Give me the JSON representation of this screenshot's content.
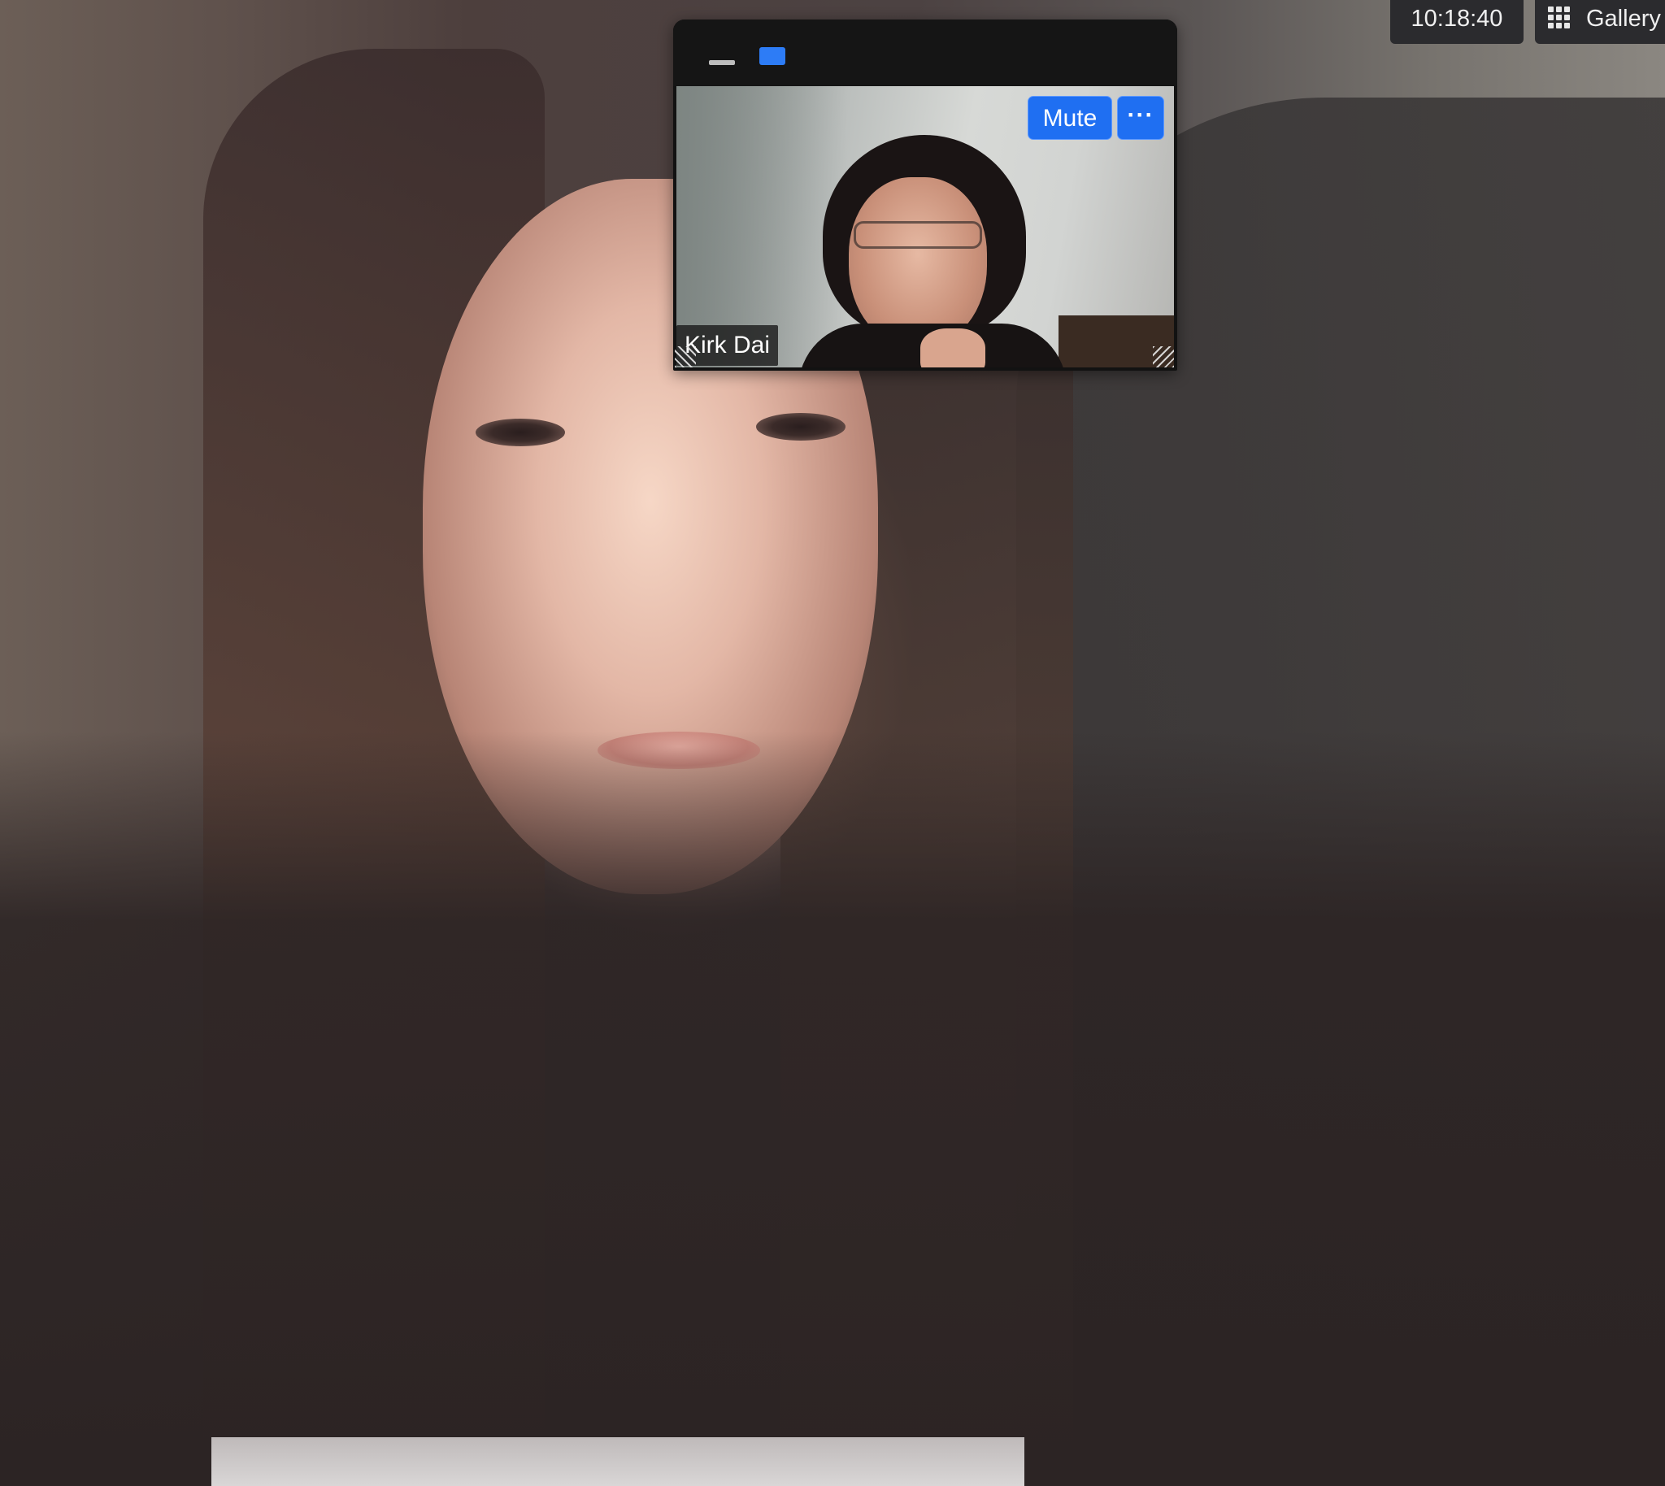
{
  "window": {
    "clock": "10:18:40",
    "view_button_label": "Gallery View"
  },
  "thumbnail": {
    "participant_name": "Kirk Dai",
    "mute_label": "Mute",
    "more_label": "···"
  },
  "colors": {
    "accent_blue": "#1f6ff2",
    "toolbar_dark": "#2b2b2e"
  },
  "icons": {
    "gallery": "grid-icon",
    "minimize": "minimize-icon",
    "restore": "restore-icon",
    "more": "ellipsis-icon",
    "resize": "resize-grip-icon"
  }
}
